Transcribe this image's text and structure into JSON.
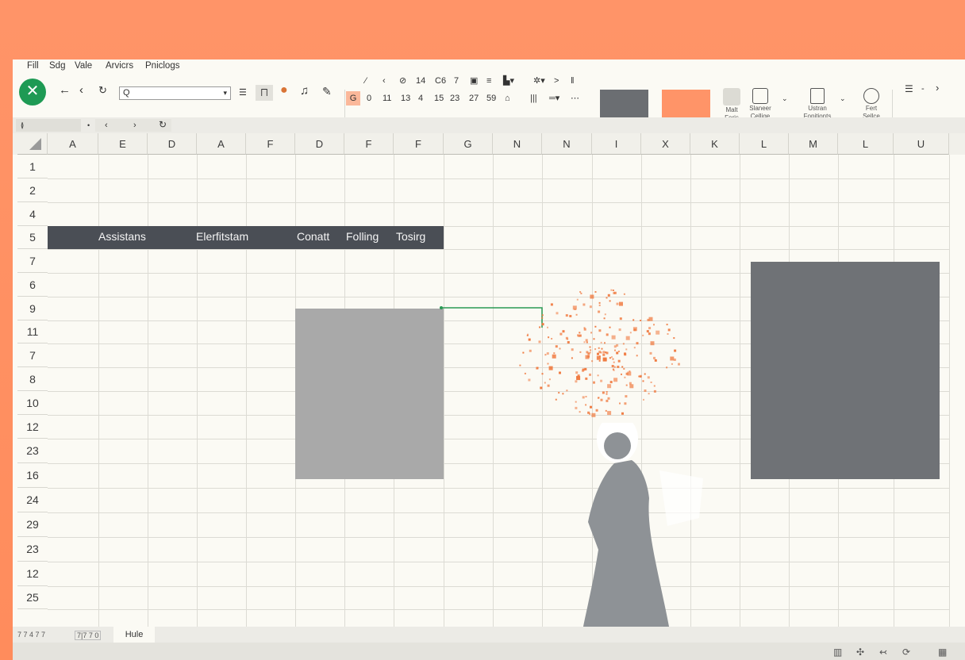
{
  "menu": [
    "Fill",
    "Sdg",
    "Vale",
    "Arvicrs",
    "Pniclogs"
  ],
  "toolbar": {
    "name_box_value": "Q",
    "font_numbers": [
      "0",
      "11",
      "13",
      "4",
      "15",
      "23",
      "27",
      "59"
    ],
    "format_top": [
      "14",
      "C6",
      "7"
    ],
    "big_buttons": [
      {
        "line1": "Malt",
        "line2": "Foris"
      },
      {
        "line1": "Slaneer",
        "line2": "Cellige"
      },
      {
        "line1": "Ustran",
        "line2": "Fopitionts"
      },
      {
        "line1": "Fert",
        "line2": "Sellce"
      }
    ],
    "accent_swatch": "#ff9468",
    "dark_swatch": "#6b6e72"
  },
  "columns": [
    "A",
    "E",
    "D",
    "A",
    "F",
    "D",
    "F",
    "F",
    "G",
    "N",
    "N",
    "I",
    "X",
    "K",
    "L",
    "M",
    "L",
    "U"
  ],
  "rows": [
    "1",
    "2",
    "4",
    "5",
    "7",
    "6",
    "9",
    "11",
    "7",
    "8",
    "10",
    "12",
    "23",
    "16",
    "24",
    "29",
    "23",
    "12",
    "25"
  ],
  "header_row": [
    "Assistans",
    "Elerfitstam",
    "Conatt",
    "Folling",
    "Tosirg"
  ],
  "sheet_tab": {
    "active": "Hule",
    "misc": "7 7 4 7 7",
    "misc2": "7|7 7 0"
  },
  "colors": {
    "accent": "#ff9468",
    "header_band": "#4a4e55",
    "excel_green": "#1e9a54",
    "gray_block": "#6f7276",
    "light_block": "#a9a9a9",
    "scatter": "#f07a40"
  }
}
